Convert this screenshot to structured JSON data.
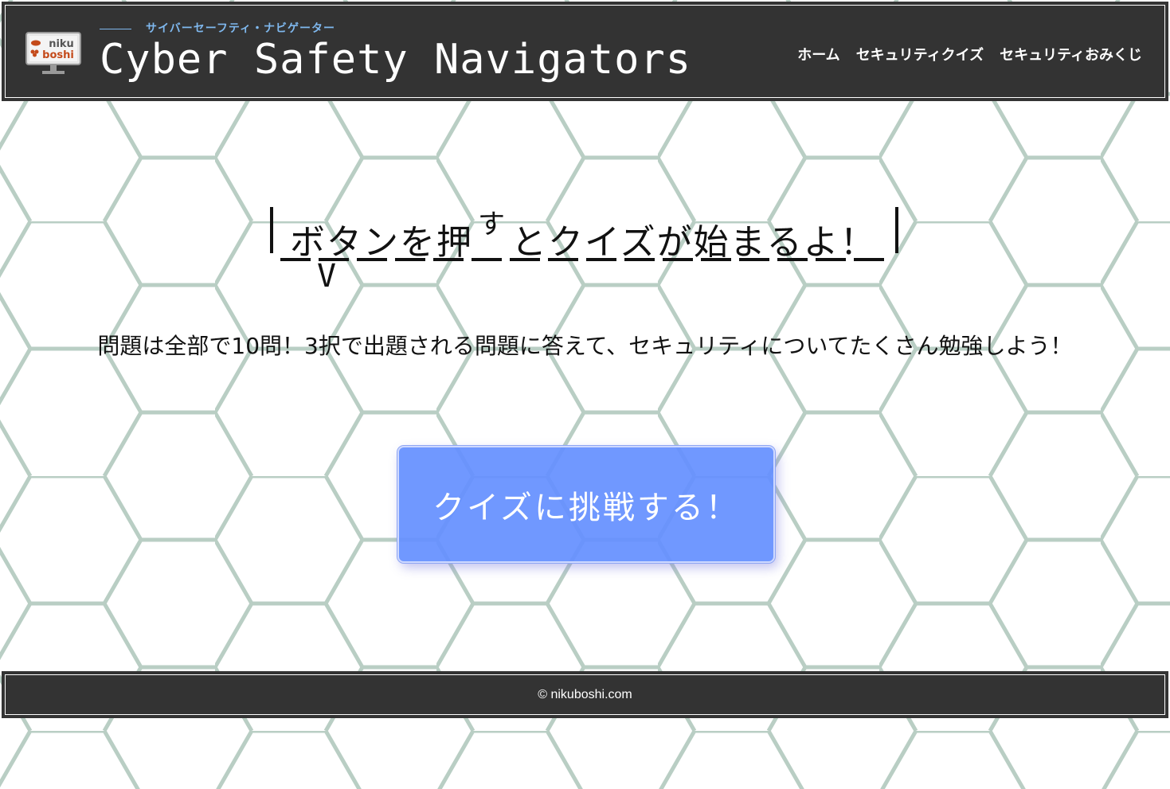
{
  "header": {
    "logo_line1": "niku",
    "logo_line2": "boshi",
    "subtitle": "サイバーセーフティ・ナビゲーター",
    "title": "Cyber Safety Navigators",
    "nav": [
      {
        "label": "ホーム"
      },
      {
        "label": "セキュリティクイズ"
      },
      {
        "label": "セキュリティおみくじ"
      }
    ]
  },
  "main": {
    "bubble_pre": "ボタンを押",
    "bubble_sup": "す",
    "bubble_post": "とクイズが始まるよ！",
    "bubble_tail": "V",
    "description": "問題は全部で10問！3択で出題される問題に答えて、セキュリティについてたくさん勉強しよう！",
    "start_button": "クイズに挑戦する！"
  },
  "footer": {
    "copyright": "© nikuboshi.com"
  },
  "colors": {
    "header_bg": "#333333",
    "accent_blue": "#7fb8ee",
    "button_bg": "#648fff",
    "hex_line": "#b9cec4"
  }
}
